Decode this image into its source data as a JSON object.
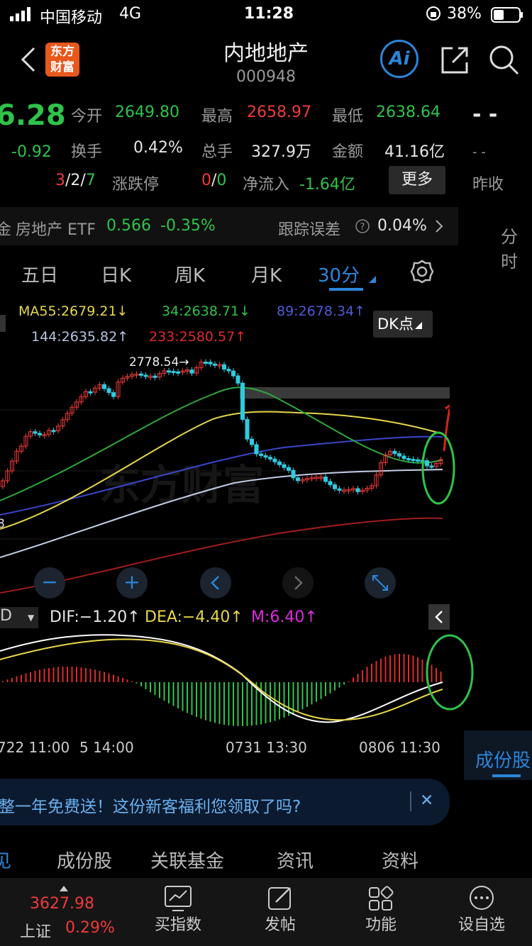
{
  "status": {
    "carrier": "中国移动",
    "network": "4G",
    "time": "11:28",
    "battery": "38%"
  },
  "header": {
    "logo": "东方\n财富",
    "title": "内地地产",
    "code": "000948",
    "ai_label": "Ai"
  },
  "quote": {
    "price": "6.28",
    "change": "-0.92",
    "open_label": "今开",
    "open": "2649.80",
    "high_label": "最高",
    "high": "2658.97",
    "low_label": "最低",
    "low": "2638.64",
    "turnover_label": "换手",
    "turnover": "0.42%",
    "volume_label": "总手",
    "volume": "327.9万",
    "amount_label": "金额",
    "amount": "41.16亿",
    "updown_a": "3",
    "updown_b": "2",
    "updown_c": "7",
    "updown_label": "涨跌停",
    "limit_a": "0",
    "limit_b": "0",
    "inflow_label": "净流入",
    "inflow": "-1.64亿",
    "more": "更多",
    "right_dash1": "- -",
    "right_dash2": "- -",
    "prev_close_label": "昨收"
  },
  "etf": {
    "prefix": "金",
    "name": "房地产 ETF",
    "price": "0.566",
    "pct": "-0.35%",
    "track_label": "跟踪误差",
    "track_value": "0.04%"
  },
  "right_tab": "分时",
  "kline_tabs": [
    "五日",
    "日K",
    "周K",
    "月K",
    "30分"
  ],
  "ma": {
    "ma55": "MA55:2679.21↓",
    "ma34": "34:2638.71↓",
    "ma89": "89:2678.34↑",
    "ma144": "144:2635.82↑",
    "ma233": "233:2580.57↑",
    "dk_button": "DK点"
  },
  "chart_marks": {
    "peak": "2778.54→",
    "left_edge": "8",
    "watermark": "东方财富"
  },
  "macd": {
    "selector": "D",
    "dif": "DIF:−1.20↑",
    "dea": "DEA:−4.40↑",
    "m": "M:6.40↑"
  },
  "time_axis": [
    "722 11:00",
    "5 14:00",
    "0731 13:30",
    "0806 11:30"
  ],
  "right_tab2": "成份股",
  "banner": {
    "text": "整一年免费送！这份新客福利您领取了吗?",
    "close": "✕"
  },
  "sub_tabs": [
    "见",
    "成份股",
    "关联基金",
    "资讯",
    "资料"
  ],
  "bottom": {
    "index_value": "3627.98",
    "index_name": "上证",
    "index_pct": "0.29%",
    "items": [
      "买指数",
      "发帖",
      "功能",
      "设自选"
    ]
  },
  "colors": {
    "up": "#f03a3a",
    "down": "#2fc34a",
    "accent": "#2b86d9",
    "bg": "#000000"
  }
}
